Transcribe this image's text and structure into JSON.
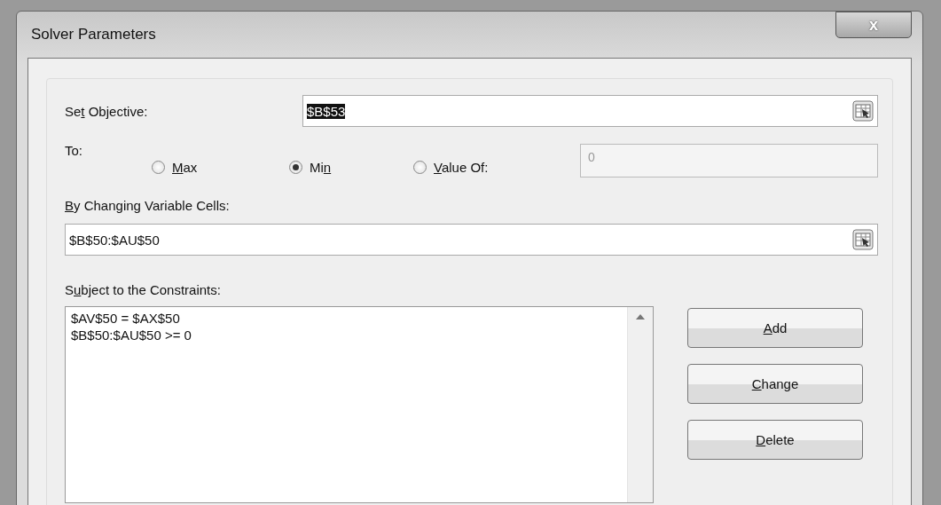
{
  "window": {
    "title": "Solver Parameters",
    "close": "x"
  },
  "objective": {
    "label": {
      "before": "Se",
      "key": "t",
      "after": " Objective:"
    },
    "value": "$B$53",
    "value_selected": true
  },
  "to": {
    "label": "To:",
    "options": [
      {
        "label": {
          "key": "M",
          "after": "ax"
        },
        "selected": false
      },
      {
        "label": {
          "before": "Mi",
          "key": "n"
        },
        "selected": true
      },
      {
        "label": {
          "key": "V",
          "after": "alue Of:"
        },
        "selected": false
      }
    ],
    "value_field": {
      "value": "0",
      "disabled": true
    }
  },
  "variable_cells": {
    "label": {
      "key": "B",
      "after": "y Changing Variable Cells:"
    },
    "value": "$B$50:$AU$50"
  },
  "constraints": {
    "label": {
      "before": "S",
      "key": "u",
      "after": "bject to the Constraints:"
    },
    "items": [
      "$AV$50 = $AX$50",
      "$B$50:$AU$50 >= 0"
    ]
  },
  "buttons": [
    {
      "key": "A",
      "after": "dd"
    },
    {
      "key": "C",
      "after": "hange"
    },
    {
      "key": "D",
      "after": "elete"
    }
  ]
}
